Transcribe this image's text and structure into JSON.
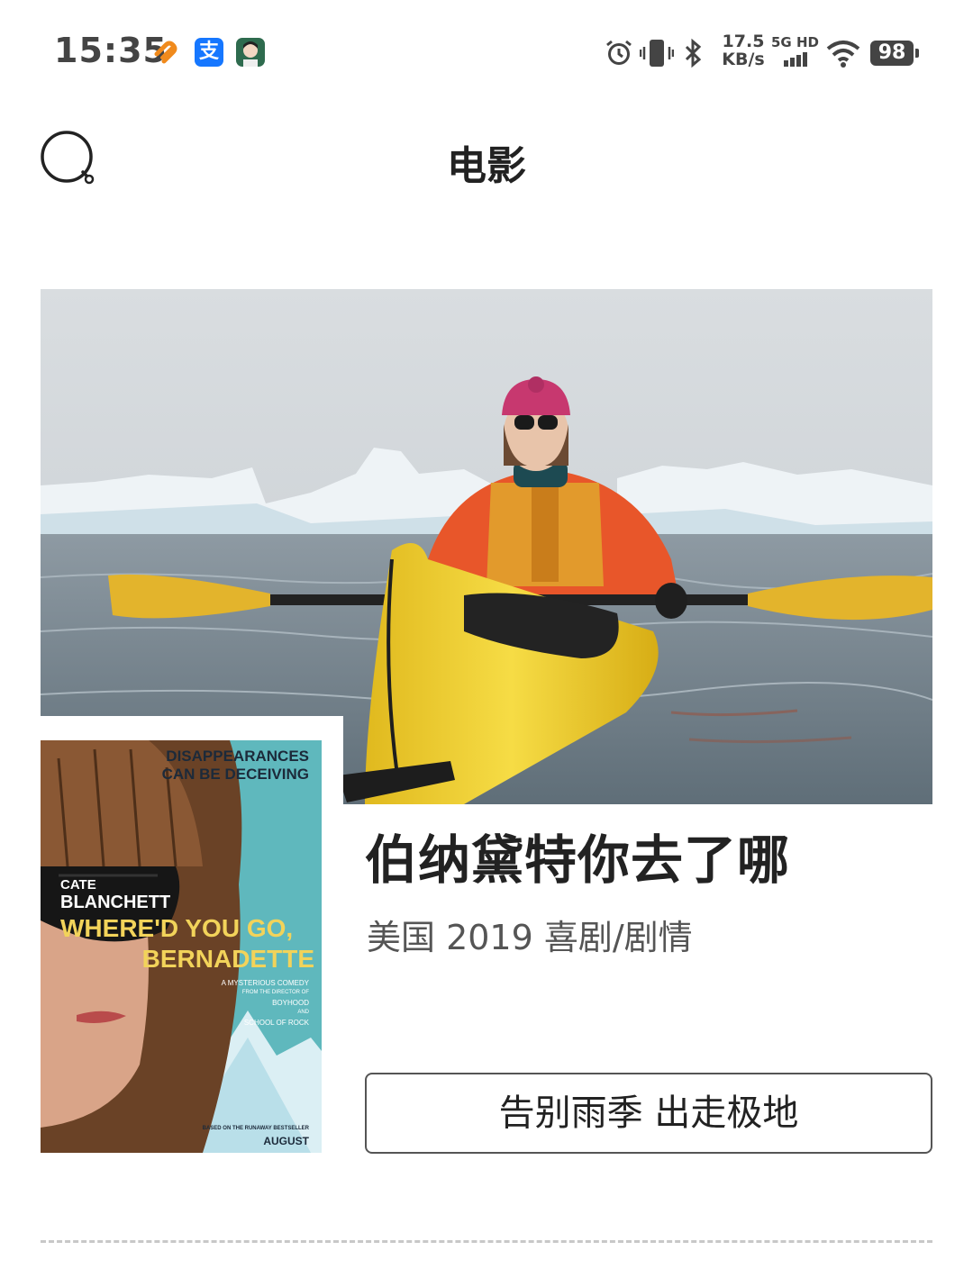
{
  "status_bar": {
    "time": "15:35",
    "alipay_glyph": "支",
    "net_speed_value": "17.5",
    "net_speed_unit": "KB/s",
    "network_type": "5G HD",
    "battery": "98",
    "icons": [
      "heart-app-icon",
      "alipay-icon",
      "avatar-app-icon",
      "alarm-icon",
      "vibrate-icon",
      "bluetooth-icon",
      "signal-icon",
      "wifi-icon",
      "battery-icon"
    ]
  },
  "header": {
    "title": "电影",
    "search_icon": "search-icon"
  },
  "movie": {
    "poster": {
      "tagline_1": "DISAPPEARANCES",
      "tagline_2": "CAN BE DECEIVING",
      "actor_first": "CATE",
      "actor_last": "BLANCHETT",
      "title_1": "WHERE'D YOU GO,",
      "title_2": "BERNADETTE",
      "sub_1": "A MYSTERIOUS COMEDY",
      "sub_2": "FROM THE DIRECTOR OF",
      "sub_3": "BOYHOOD",
      "sub_4": "AND",
      "sub_5": "SCHOOL OF ROCK",
      "bottom_note": "BASED ON THE RUNAWAY BESTSELLER",
      "release": "AUGUST"
    },
    "title": "伯纳黛特你去了哪",
    "meta": "美国 2019 喜剧/剧情",
    "tagline_button": "告别雨季 出走极地"
  },
  "colors": {
    "poster_bg": "#5fb8bd",
    "kayak_yellow": "#f2d23a",
    "jacket_orange": "#e8562a",
    "text_dark": "#222222",
    "divider": "#c8c8c8"
  }
}
